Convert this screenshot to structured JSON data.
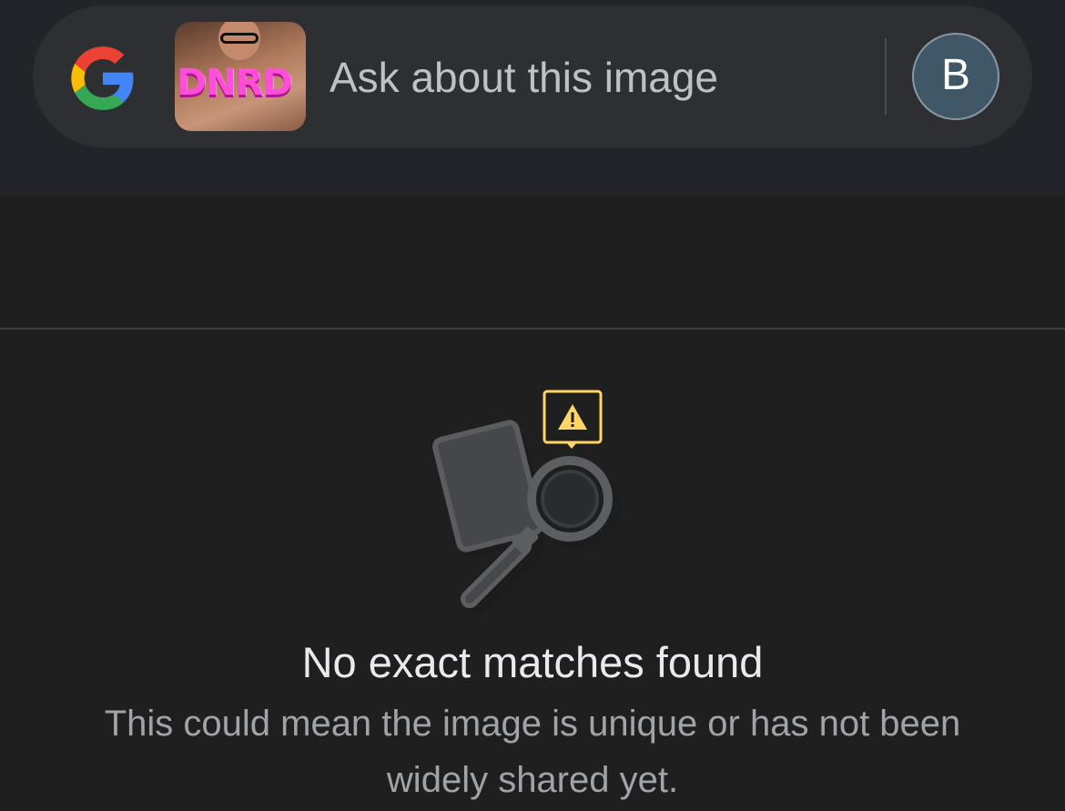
{
  "search": {
    "placeholder": "Ask about this image",
    "thumbnail_text": "DNRD",
    "thumbnail_label": "query-image-thumbnail"
  },
  "account": {
    "avatar_initial": "B"
  },
  "icons": {
    "logo": "google-g-logo-icon",
    "illustration": "no-results-magnifier-icon",
    "warning": "warning-icon"
  },
  "result": {
    "title": "No exact matches found",
    "message": "This could mean the image is unique or has not been widely shared yet."
  },
  "colors": {
    "background": "#1f1f1f",
    "search_bar": "#2d2f33",
    "avatar_bg": "#3f5766",
    "warning_yellow": "#fdd663",
    "google_blue": "#4285f4",
    "google_red": "#ea4335",
    "google_yellow": "#fbbc05",
    "google_green": "#34a853"
  }
}
